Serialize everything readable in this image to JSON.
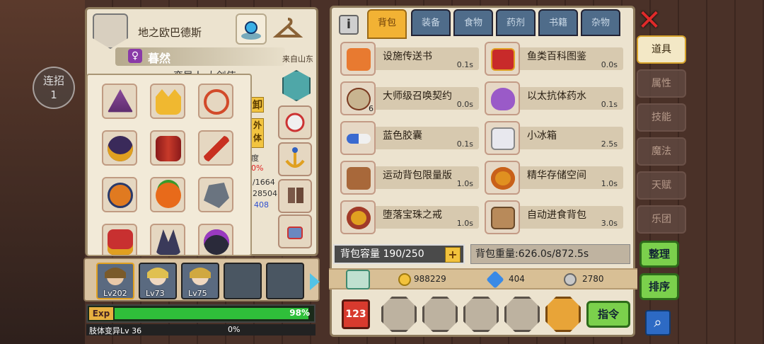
{
  "hud": {
    "combo_label": "连招",
    "combo_count": "1"
  },
  "character": {
    "name": "地之欧巴德斯",
    "player_name": "暮然",
    "gender_symbol": "♀",
    "origin": "来自山东",
    "subtitle": "変异人 大剑使",
    "tag_1": "卸",
    "tag_2": "外\n体",
    "frag_1": "度",
    "frag_2": "0%",
    "frag_3": "/1664",
    "frag_4": "28504",
    "frag_5": "408"
  },
  "team": [
    {
      "level": "Lv202"
    },
    {
      "level": "Lv73"
    },
    {
      "level": "Lv75"
    }
  ],
  "exp": {
    "label": "Exp",
    "percent": 98,
    "percent_text": "98%"
  },
  "body_mutation": {
    "label": "肢体变异Lv 36",
    "percent_text": "0%"
  },
  "bag": {
    "tabs": [
      "背包",
      "装备",
      "食物",
      "药剂",
      "书籍",
      "杂物"
    ],
    "active_tab": "背包",
    "items": [
      {
        "name": "设施传送书",
        "time": "0.1s"
      },
      {
        "name": "鱼类百科图鉴",
        "time": "0.0s"
      },
      {
        "name": "大师级召唤契约",
        "time": "0.0s",
        "count": "6"
      },
      {
        "name": "以太抗体药水",
        "time": "0.1s"
      },
      {
        "name": "蓝色胶囊",
        "time": "0.1s"
      },
      {
        "name": "小冰箱",
        "time": "2.5s"
      },
      {
        "name": "运动背包限量版",
        "time": "1.0s"
      },
      {
        "name": "精华存储空间",
        "time": "1.0s"
      },
      {
        "name": "堕落宝珠之戒",
        "time": "1.0s"
      },
      {
        "name": "自动进食背包",
        "time": "3.0s"
      }
    ],
    "capacity": "背包容量 190/250",
    "weight": "背包重量:626.0s/872.5s",
    "currency": {
      "gold": "988229",
      "diamond": "404",
      "silver": "2780"
    },
    "command_label": "指令",
    "bottom_red_label": "123"
  },
  "side_tabs": [
    "道具",
    "属性",
    "技能",
    "魔法",
    "天赋",
    "乐团"
  ],
  "side_active": "道具",
  "actions": {
    "arrange": "整理",
    "sort": "排序"
  },
  "colors": {
    "tab_active": "#f2b234",
    "tab_inactive": "#4f6c8a",
    "accent_green": "#7bd04c",
    "close_red": "#e02a2a"
  }
}
